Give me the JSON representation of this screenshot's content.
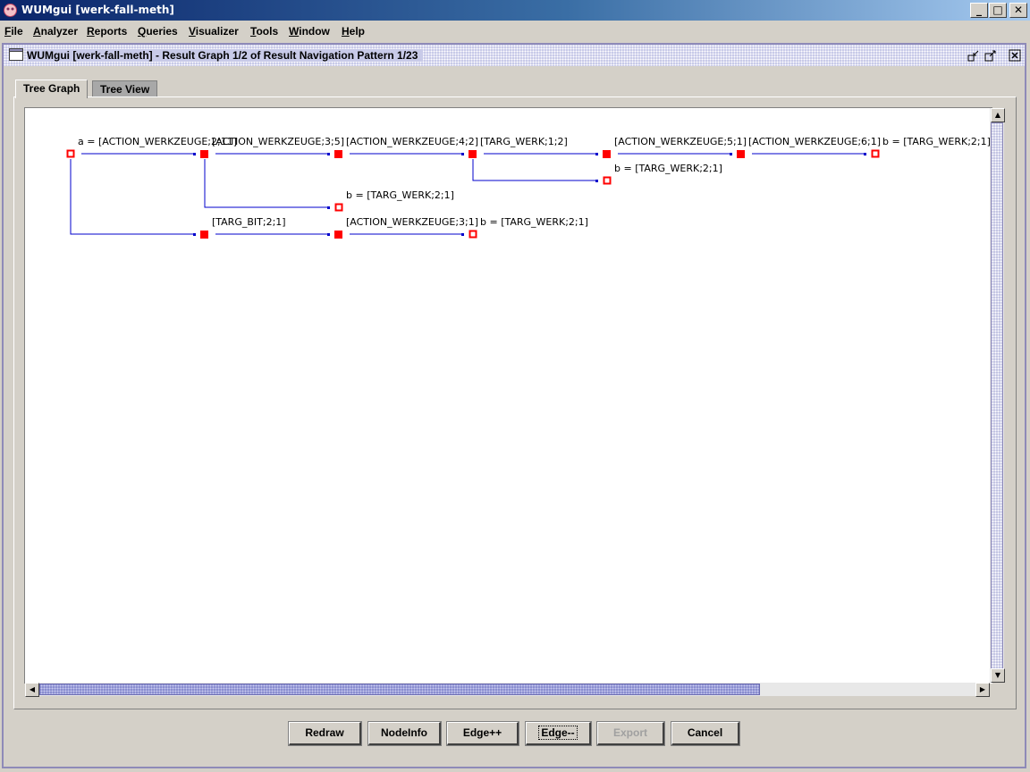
{
  "window": {
    "title": "WUMgui [werk-fall-meth]",
    "accent": "#0a246a"
  },
  "menu": [
    "File",
    "Analyzer",
    "Reports",
    "Queries",
    "Visualizer",
    "Tools",
    "Window",
    "Help"
  ],
  "frame": {
    "title": "WUMgui [werk-fall-meth] - Result Graph 1/2 of Result Navigation Pattern 1/23"
  },
  "tabs": [
    {
      "label": "Tree Graph",
      "active": true
    },
    {
      "label": "Tree View",
      "active": false
    }
  ],
  "graph": {
    "edge_color": "#0000cc",
    "node_color": "#ff0000",
    "labels": [
      "a = [ACTION_WERKZEUGE;2;11]",
      "[ACTION_WERKZEUGE;3;5]",
      "[ACTION_WERKZEUGE;4;2]",
      "[TARG_WERK;1;2]",
      "[ACTION_WERKZEUGE;5;1]",
      "[ACTION_WERKZEUGE;6;1]",
      "b = [TARG_WERK;2;1]",
      "b = [TARG_WERK;2;1]",
      "b = [TARG_WERK;2;1]",
      "[TARG_BIT;2;1]",
      "[ACTION_WERKZEUGE;3;1]",
      "b = [TARG_WERK;2;1]"
    ]
  },
  "buttons": {
    "redraw": "Redraw",
    "nodeinfo": "NodeInfo",
    "edge_plus": "Edge++",
    "edge_minus": "Edge--",
    "export": "Export",
    "cancel": "Cancel"
  }
}
